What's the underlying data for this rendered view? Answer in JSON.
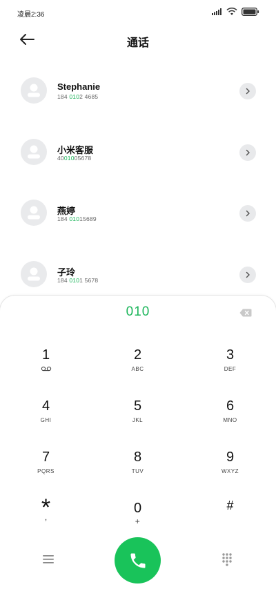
{
  "status": {
    "time": "凌晨2:36"
  },
  "header": {
    "title": "通话"
  },
  "contacts": [
    {
      "name": "Stephanie",
      "number_pre": "184 ",
      "number_hl": "010",
      "number_post": "2 4685"
    },
    {
      "name": "小米客服",
      "number_pre": "40",
      "number_hl": "010",
      "number_post": "05678"
    },
    {
      "name": "燕婷",
      "number_pre": "184 ",
      "number_hl": "010",
      "number_post": "15689"
    },
    {
      "name": "子玲",
      "number_pre": "184 ",
      "number_hl": "010",
      "number_post": "1 5678"
    }
  ],
  "dialer": {
    "input": "010",
    "keys": [
      {
        "digit": "1",
        "letters": ""
      },
      {
        "digit": "2",
        "letters": "ABC"
      },
      {
        "digit": "3",
        "letters": "DEF"
      },
      {
        "digit": "4",
        "letters": "GHI"
      },
      {
        "digit": "5",
        "letters": "JKL"
      },
      {
        "digit": "6",
        "letters": "MNO"
      },
      {
        "digit": "7",
        "letters": "PQRS"
      },
      {
        "digit": "8",
        "letters": "TUV"
      },
      {
        "digit": "9",
        "letters": "WXYZ"
      },
      {
        "digit": "*",
        "letters": ","
      },
      {
        "digit": "0",
        "letters": "+"
      },
      {
        "digit": "#",
        "letters": ""
      }
    ]
  },
  "colors": {
    "accent": "#1bb55a",
    "call_button": "#19c35a"
  }
}
